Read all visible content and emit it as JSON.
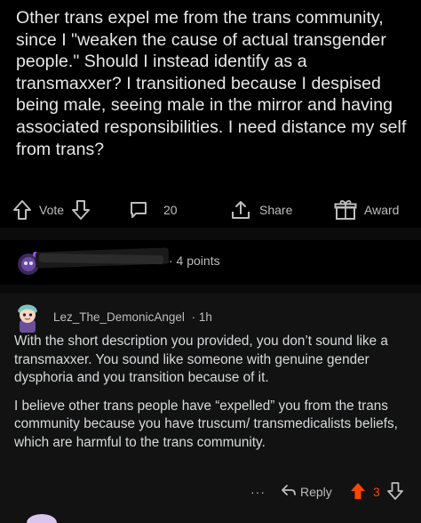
{
  "post": {
    "title": "Other trans expel me from the trans community, since I \"weaken the cause of actual transgender people.\" Should I instead identify as a transmaxxer? I transitioned because I despised being male, seeing male in the mirror and having associated responsibilities. I need distance my self from trans?"
  },
  "post_actions": {
    "vote_label": "Vote",
    "comment_count": "20",
    "share_label": "Share",
    "award_label": "Award"
  },
  "collapsed_comment": {
    "points": "· 4 points"
  },
  "comment": {
    "author": "Lez_The_DemonicAngel",
    "time": "· 1h",
    "paragraph_1": "With the short description you provided, you don’t sound like a transmaxxer. You sound like someone with genuine gender dysphoria and you transition because of it.",
    "paragraph_2": "I believe other trans people have “expelled” you from the trans community because you have truscum/ transmedicalists beliefs, which are harmful to the trans community.",
    "more_label": "···",
    "reply_label": "Reply",
    "score": "3"
  },
  "colors": {
    "background": "#000000",
    "comment_bg": "#121212",
    "text": "#d7dadc",
    "muted": "#bdbdbd",
    "upvote": "#ff4500"
  },
  "icons": [
    "arrow-up-icon",
    "arrow-down-icon",
    "comment-icon",
    "share-icon",
    "award-icon",
    "avatar-icon",
    "more-icon",
    "reply-icon"
  ]
}
